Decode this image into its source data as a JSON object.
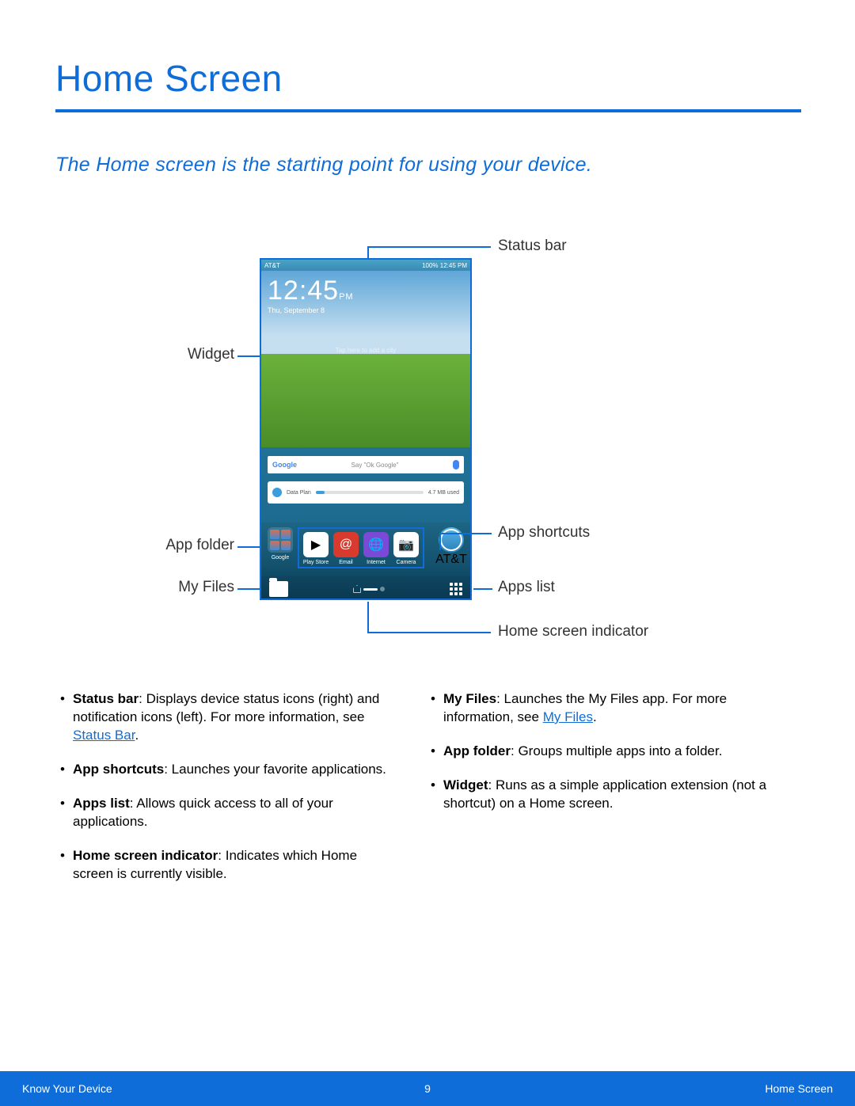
{
  "title": "Home Screen",
  "subtitle": "The Home screen is the starting point for using your device.",
  "callouts": {
    "status_bar": "Status bar",
    "widget": "Widget",
    "app_shortcuts": "App shortcuts",
    "app_folder": "App folder",
    "my_files": "My Files",
    "apps_list": "Apps list",
    "home_indicator": "Home screen indicator"
  },
  "screenshot": {
    "carrier": "AT&T",
    "status_right": "100%  12:45 PM",
    "time": "12:45",
    "ampm": "PM",
    "date": "Thu, September 8",
    "hint": "Tap here to add a city",
    "search_left": "Google",
    "search_hint": "Say \"Ok Google\"",
    "data_label": "Data Plan",
    "data_used": "4.7 MB used",
    "folder_label": "Google",
    "shortcuts": [
      "Play Store",
      "Email",
      "Internet",
      "Camera"
    ],
    "att_label": "AT&T"
  },
  "bullets_left": [
    {
      "term": "Status bar",
      "text": ": Displays device status icons (right) and notification icons (left). For more information, see ",
      "link": "Status Bar",
      "after": "."
    },
    {
      "term": "App shortcuts",
      "text": ": Launches your favorite applications."
    },
    {
      "term": "Apps list",
      "text": ": Allows quick access to all of your applications."
    },
    {
      "term": "Home screen indicator",
      "text": ": Indicates which Home screen is currently visible."
    }
  ],
  "bullets_right": [
    {
      "term": "My Files",
      "text": ": Launches the My Files app. For more information, see ",
      "link": "My Files",
      "after": "."
    },
    {
      "term": "App folder",
      "text": ": Groups multiple apps into a folder."
    },
    {
      "term": "Widget",
      "text": ": Runs as a simple application extension (not a shortcut) on a Home screen."
    }
  ],
  "footer": {
    "left": "Know Your Device",
    "page": "9",
    "right": "Home Screen"
  }
}
